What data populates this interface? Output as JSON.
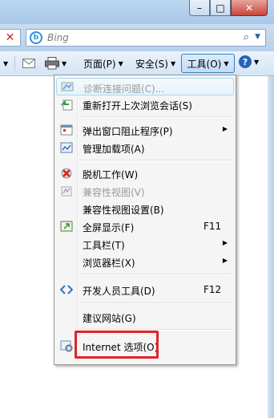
{
  "window": {
    "minimize_symbol": "–",
    "maximize_symbol": "□",
    "close_symbol": "✕"
  },
  "search": {
    "placeholder": "Bing",
    "stop_symbol": "✕"
  },
  "commandbar": {
    "page_label": "页面(P)",
    "safety_label": "安全(S)",
    "tools_label": "工具(O)",
    "help_symbol": "?"
  },
  "tools_menu": {
    "items": [
      {
        "label": "诊断连接问题(C)...",
        "icon": "diagnose-icon"
      },
      {
        "label": "重新打开上次浏览会话(S)",
        "icon": "reopen-session-icon"
      },
      {
        "label": "弹出窗口阻止程序(P)",
        "icon": "popup-blocker-icon"
      },
      {
        "label": "管理加载项(A)",
        "icon": "addons-icon"
      },
      {
        "label": "脱机工作(W)",
        "icon": "offline-icon"
      },
      {
        "label": "兼容性视图(V)",
        "icon": "compat-view-icon"
      },
      {
        "label": "兼容性视图设置(B)"
      },
      {
        "label": "全屏显示(F)",
        "icon": "fullscreen-icon",
        "shortcut": "F11"
      },
      {
        "label": "工具栏(T)"
      },
      {
        "label": "浏览器栏(X)"
      },
      {
        "label": "开发人员工具(D)",
        "icon": "devtools-icon",
        "shortcut": "F12"
      },
      {
        "label": "建议网站(G)"
      },
      {
        "label": "Internet 选项(O)",
        "icon": "internet-options-icon"
      }
    ]
  },
  "colors": {
    "highlight_border": "#e0252a",
    "accent": "#2a62b5"
  }
}
